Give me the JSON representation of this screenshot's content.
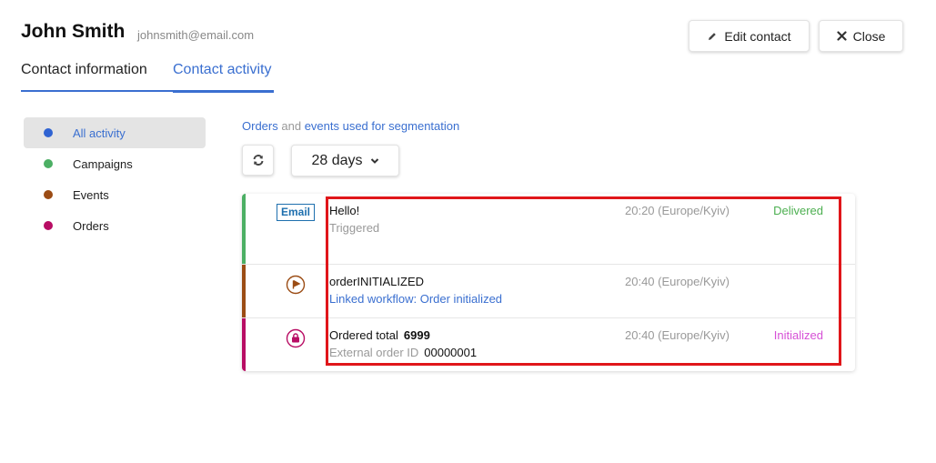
{
  "header": {
    "name": "John Smith",
    "email": "johnsmith@email.com",
    "edit_label": "Edit contact",
    "close_label": "Close"
  },
  "tabs": [
    {
      "label": "Contact information",
      "active": false
    },
    {
      "label": "Contact activity",
      "active": true
    }
  ],
  "sidebar": {
    "items": [
      {
        "label": "All activity",
        "color": "#2f63d2",
        "active": true
      },
      {
        "label": "Campaigns",
        "color": "#4caf64",
        "active": false
      },
      {
        "label": "Events",
        "color": "#9b4c14",
        "active": false
      },
      {
        "label": "Orders",
        "color": "#b80d64",
        "active": false
      }
    ]
  },
  "segmentation": {
    "link1": "Orders",
    "connector": "and",
    "link2": "events used for segmentation"
  },
  "filter": {
    "period": "28 days"
  },
  "feed": [
    {
      "type": "campaign",
      "bar_color": "#4caf64",
      "badge": "Email",
      "title": "Hello!",
      "subtitle": "Triggered",
      "time": "20:20 (Europe/Kyiv)",
      "status": "Delivered",
      "status_color": "#4caf50"
    },
    {
      "type": "event",
      "bar_color": "#9b4c14",
      "icon": "flag-icon",
      "title": "orderINITIALIZED",
      "subtitle": "Linked workflow: Order initialized",
      "time": "20:40 (Europe/Kyiv)",
      "status": ""
    },
    {
      "type": "order",
      "bar_color": "#b80d64",
      "icon": "shopping-bag-icon",
      "title_label": "Ordered total",
      "title_value": "6999",
      "subtitle_label": "External order ID",
      "subtitle_value": "00000001",
      "time": "20:40 (Europe/Kyiv)",
      "status": "Initialized",
      "status_color": "#d650d6"
    }
  ]
}
